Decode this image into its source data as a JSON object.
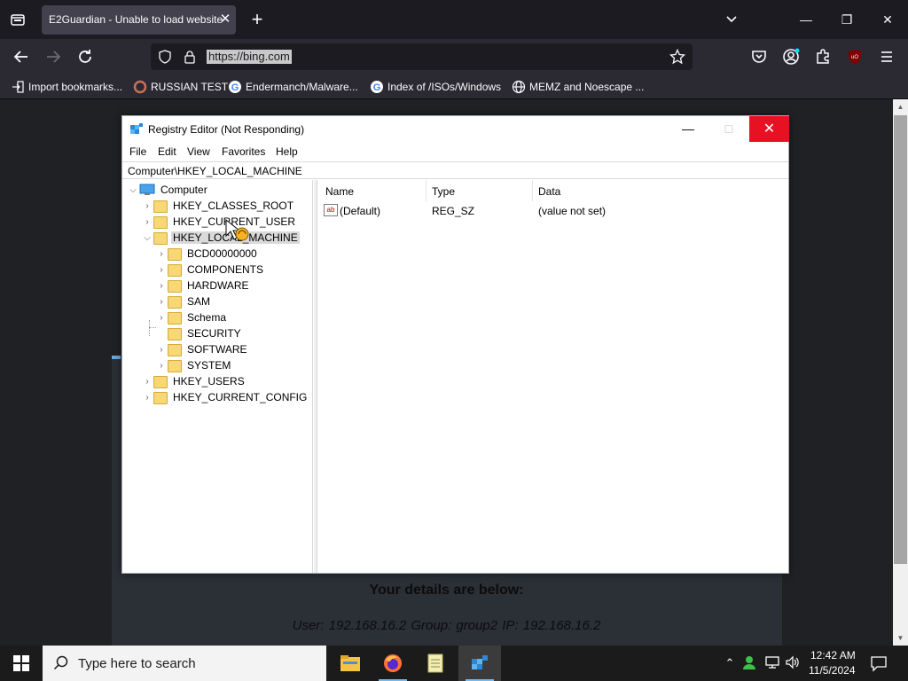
{
  "browser": {
    "tab": {
      "title": "E2Guardian - Unable to load website",
      "close": "✕"
    },
    "new_tab": "+",
    "url": "https://bing.com",
    "window_controls": {
      "minimize": "—",
      "restore": "❐",
      "close": "✕"
    },
    "bookmarks": [
      {
        "label": "Import bookmarks...",
        "icon": "import-icon"
      },
      {
        "label": "RUSSIAN TEST",
        "icon": "favicon"
      },
      {
        "label": "Endermanch/Malware...",
        "icon": "google-icon"
      },
      {
        "label": "Index of /ISOs/Windows",
        "icon": "google-icon"
      },
      {
        "label": "MEMZ and Noescape ...",
        "icon": "globe-icon"
      }
    ]
  },
  "page": {
    "details_heading": "Your details are below:",
    "details_line": "User: 192.168.16.2   Group: group2   IP: 192.168.16.2"
  },
  "regedit": {
    "title": "Registry Editor (Not Responding)",
    "controls": {
      "minimize": "—",
      "maximize": "☐",
      "close": "✕"
    },
    "menu": [
      "File",
      "Edit",
      "View",
      "Favorites",
      "Help"
    ],
    "address": "Computer\\HKEY_LOCAL_MACHINE",
    "tree": {
      "root": "Computer",
      "hives": [
        "HKEY_CLASSES_ROOT",
        "HKEY_CURRENT_USER",
        "HKEY_LOCAL_MACHINE",
        "HKEY_USERS",
        "HKEY_CURRENT_CONFIG"
      ],
      "hklm_children": [
        "BCD00000000",
        "COMPONENTS",
        "HARDWARE",
        "SAM",
        "Schema",
        "SECURITY",
        "SOFTWARE",
        "SYSTEM"
      ]
    },
    "columns": [
      "Name",
      "Type",
      "Data"
    ],
    "values": [
      {
        "name": "(Default)",
        "type": "REG_SZ",
        "data": "(value not set)"
      }
    ]
  },
  "taskbar": {
    "search_placeholder": "Type here to search",
    "time": "12:42 AM",
    "date": "11/5/2024"
  },
  "colors": {
    "close_red": "#e81123",
    "selection_gray": "#d9d9d9",
    "folder_yellow": "#f8d775"
  }
}
